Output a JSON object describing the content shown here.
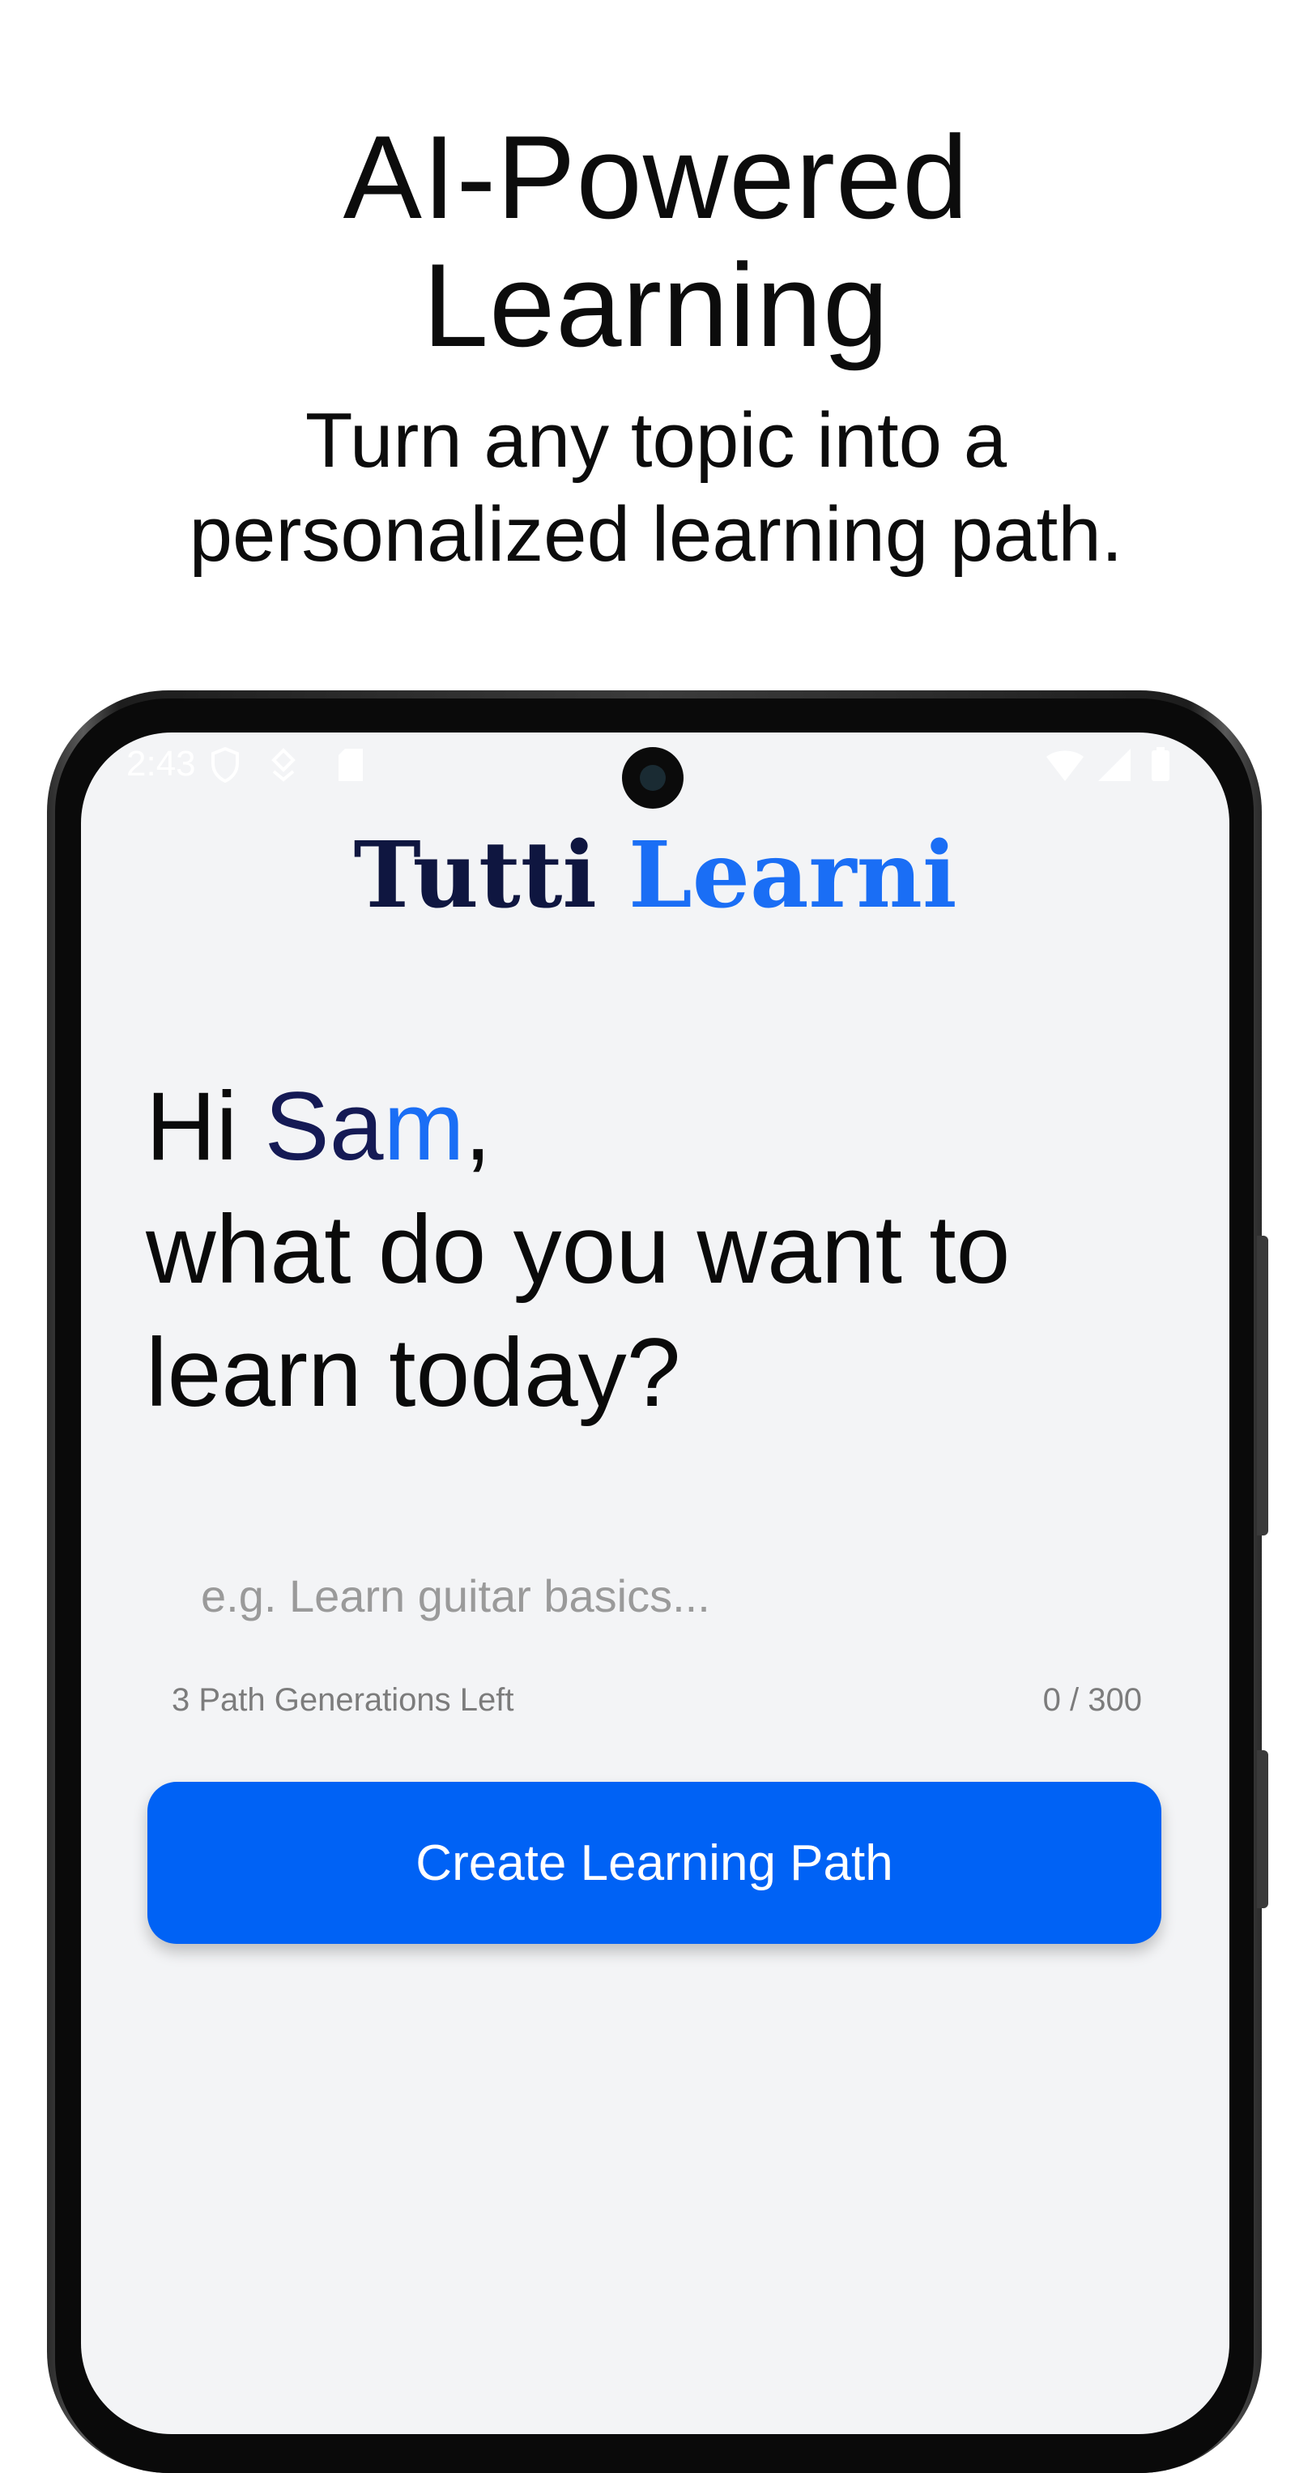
{
  "promo": {
    "title_line_1": "AI-Powered",
    "title_line_2": "Learning",
    "subtitle_line_1": "Turn any topic into a",
    "subtitle_line_2": "personalized learning path."
  },
  "status_bar": {
    "time": "2:43"
  },
  "app": {
    "logo_part_1": "Tutti ",
    "logo_part_2": "Learni"
  },
  "greeting": {
    "hi": "Hi ",
    "name_part_1": "Sa",
    "name_part_2": "m",
    "comma": ",",
    "line_2": "what do you want to",
    "line_3": "learn today?"
  },
  "input": {
    "placeholder": "e.g. Learn guitar basics...",
    "value": ""
  },
  "helper": {
    "generations_left": "3 Path Generations Left",
    "char_count": "0 / 300"
  },
  "button": {
    "create_label": "Create Learning Path"
  },
  "colors": {
    "brand_dark": "#0f1640",
    "brand_blue": "#1a6ef5",
    "button_blue": "#0062f5",
    "screen_bg": "#f3f4f6"
  },
  "icons": [
    "shield-icon",
    "notification-icon",
    "sim-card-icon",
    "wifi-icon",
    "signal-icon",
    "battery-icon"
  ]
}
